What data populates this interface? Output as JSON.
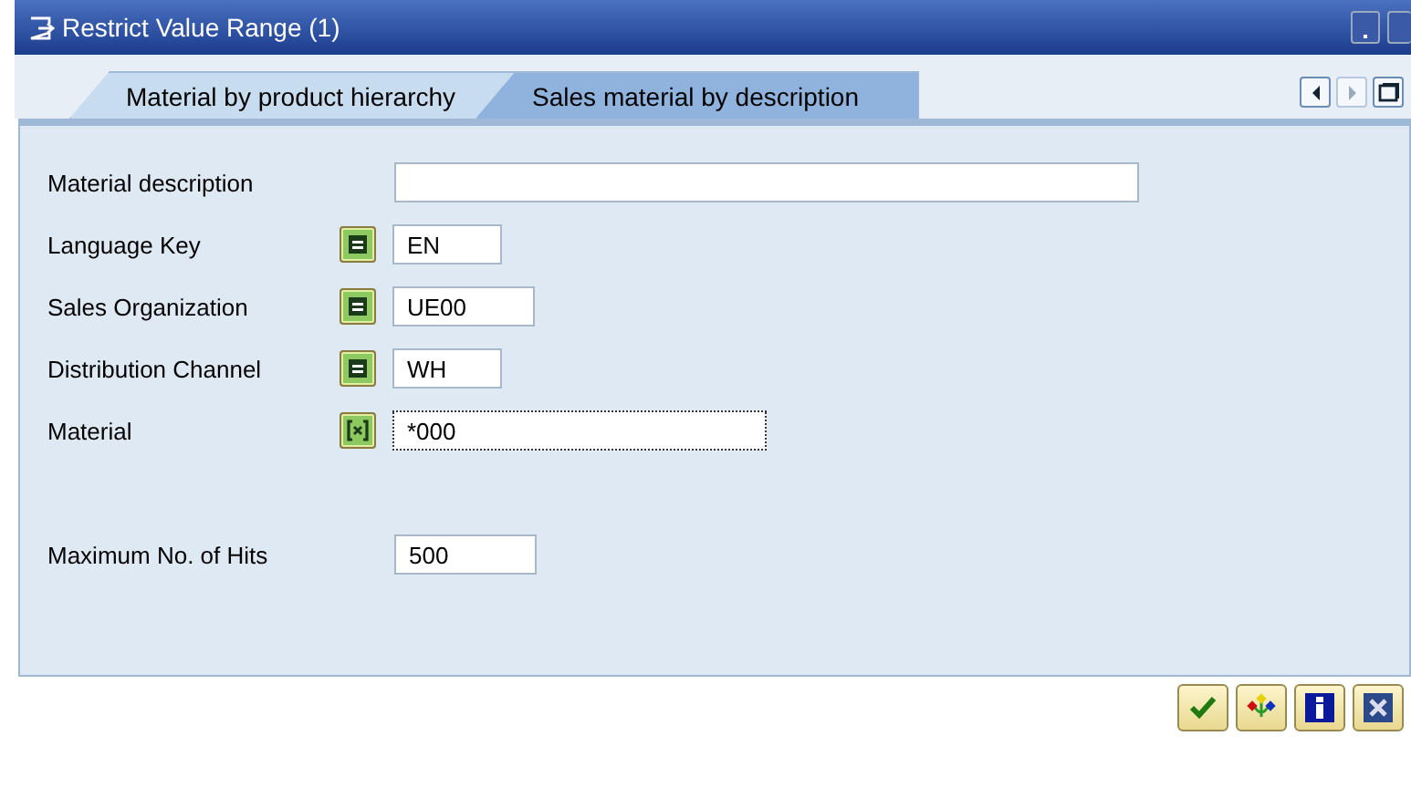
{
  "window": {
    "title": "Restrict Value Range (1)"
  },
  "tabs": [
    {
      "label": "Material by product hierarchy",
      "selected": false
    },
    {
      "label": "Sales material by description",
      "selected": true
    }
  ],
  "tab_scroll": [
    {
      "kind": "left",
      "disabled": false
    },
    {
      "kind": "right",
      "disabled": true
    },
    {
      "kind": "list",
      "disabled": false
    }
  ],
  "fields": [
    {
      "label": "Material description",
      "kind": "plain",
      "focused": false
    },
    {
      "label": "Language Key",
      "kind": "equal",
      "value": "EN",
      "focused": false
    },
    {
      "label": "Sales Organization",
      "kind": "equal",
      "value": "UE00",
      "focused": false
    },
    {
      "label": "Distribution Channel",
      "kind": "equal",
      "value": "WH",
      "focused": false
    },
    {
      "label": "Material",
      "kind": "pattern",
      "value": "*000",
      "focused": true
    }
  ],
  "max_hits": {
    "label": "Maximum No. of Hits",
    "value": "500"
  },
  "buttons": [
    {
      "kind": "ok"
    },
    {
      "kind": "hierarchy"
    },
    {
      "kind": "info"
    },
    {
      "kind": "cancel"
    }
  ]
}
